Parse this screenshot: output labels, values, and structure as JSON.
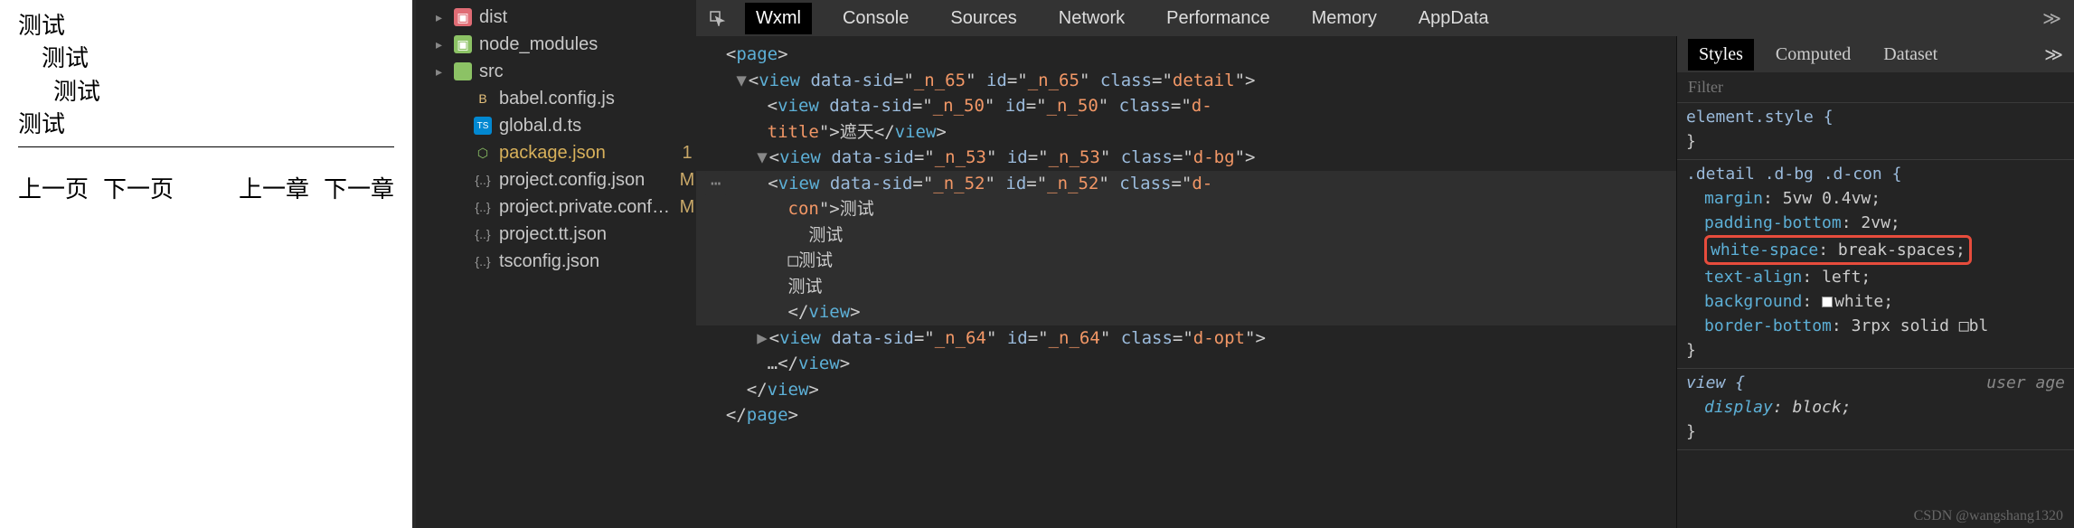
{
  "preview": {
    "lines": [
      "测试",
      "测试",
      "测试",
      "测试"
    ],
    "nav": {
      "prevPage": "上一页",
      "nextPage": "下一页",
      "prevChapter": "上一章",
      "nextChapter": "下一章"
    }
  },
  "fileTree": {
    "items": [
      {
        "name": "dist",
        "type": "folder",
        "icon": "dist",
        "chevron": "▸"
      },
      {
        "name": "node_modules",
        "type": "folder",
        "icon": "node",
        "chevron": "▸"
      },
      {
        "name": "src",
        "type": "folder",
        "icon": "src",
        "chevron": "▸"
      },
      {
        "name": "babel.config.js",
        "type": "file",
        "icon": "babel",
        "status": ""
      },
      {
        "name": "global.d.ts",
        "type": "file",
        "icon": "ts",
        "status": ""
      },
      {
        "name": "package.json",
        "type": "file",
        "icon": "npm",
        "status": "1",
        "selected": true
      },
      {
        "name": "project.config.json",
        "type": "file",
        "icon": "json",
        "status": "M"
      },
      {
        "name": "project.private.config...",
        "type": "file",
        "icon": "json",
        "status": "M"
      },
      {
        "name": "project.tt.json",
        "type": "file",
        "icon": "json",
        "status": ""
      },
      {
        "name": "tsconfig.json",
        "type": "file",
        "icon": "json",
        "status": ""
      }
    ]
  },
  "devtools": {
    "tabs": [
      "Wxml",
      "Console",
      "Sources",
      "Network",
      "Performance",
      "Memory",
      "AppData"
    ],
    "activeTab": "Wxml",
    "moreGlyph": "≫"
  },
  "wxml": {
    "l1": {
      "tag": "page"
    },
    "l2": {
      "tag": "view",
      "sid": "_n_65",
      "id": "_n_65",
      "cls": "detail"
    },
    "l3": {
      "tag": "view",
      "sid": "_n_50",
      "id": "_n_50",
      "cls": "d-title",
      "text": "遮天"
    },
    "l4": {
      "tag": "view",
      "sid": "_n_53",
      "id": "_n_53",
      "cls": "d-bg"
    },
    "l5": {
      "tag": "view",
      "sid": "_n_52",
      "id": "_n_52",
      "cls": "d-con"
    },
    "content": [
      "测试",
      "  测试",
      " □测试",
      "测试"
    ],
    "closeView": "</view>",
    "l6": {
      "tag": "view",
      "sid": "_n_64",
      "id": "_n_64",
      "cls": "d-opt"
    },
    "ellipsisText": "…",
    "closePage": "</page>"
  },
  "stylesPanel": {
    "tabs": [
      "Styles",
      "Computed",
      "Dataset"
    ],
    "activeTab": "Styles",
    "filterPlaceholder": "Filter",
    "rule1": {
      "selector": "element.style {",
      "close": "}"
    },
    "rule2": {
      "selector": ".detail .d-bg .d-con {",
      "props": [
        {
          "n": "margin",
          "v": "5vw 0.4vw;"
        },
        {
          "n": "padding-bottom",
          "v": "2vw;"
        },
        {
          "n": "white-space",
          "v": "break-spaces;",
          "hl": true
        },
        {
          "n": "text-align",
          "v": "left;"
        },
        {
          "n": "background",
          "v": "white;",
          "swatch": true
        },
        {
          "n": "border-bottom",
          "v": "3rpx solid □bl"
        }
      ],
      "close": "}"
    },
    "rule3": {
      "selector": "view {",
      "ua": "user age",
      "props": [
        {
          "n": "display",
          "v": "block;",
          "italic": true
        }
      ],
      "close": "}"
    }
  },
  "watermark": "CSDN @wangshang1320"
}
